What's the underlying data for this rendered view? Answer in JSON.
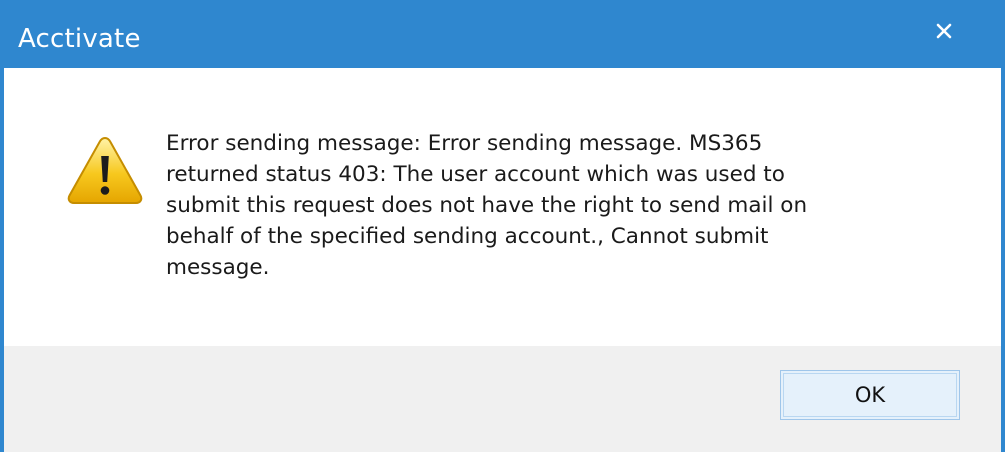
{
  "window": {
    "title": "Acctivate",
    "accent_color": "#2f87cf",
    "close_icon": "close-icon"
  },
  "message": {
    "icon": "warning-icon",
    "text": "Error sending message: Error sending message. MS365\nreturned status 403: The user account which was used to\nsubmit this request does not have the right to send mail on\nbehalf of the specified sending account., Cannot submit\nmessage."
  },
  "buttons": {
    "ok_label": "OK"
  }
}
